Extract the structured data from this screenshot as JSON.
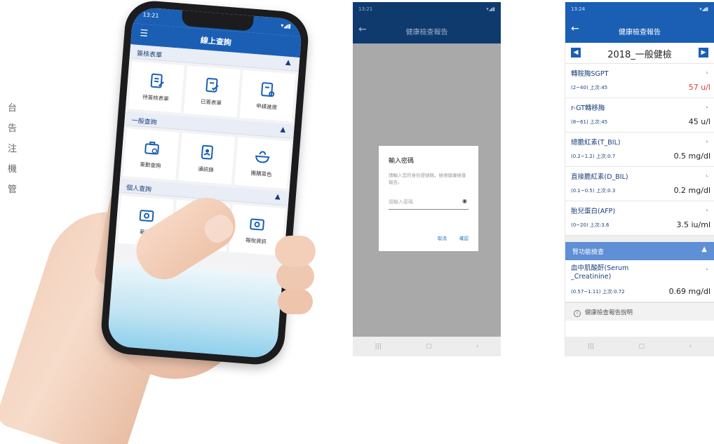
{
  "side_text": [
    "台",
    "告",
    "注",
    "機",
    "管"
  ],
  "phone1": {
    "status_time": "13:21",
    "title": "線上查詢",
    "sections": [
      {
        "name": "簽核表單",
        "tiles": [
          "待簽核表單",
          "已簽表單",
          "申請進度"
        ]
      },
      {
        "name": "一般查詢",
        "tiles": [
          "差勤查詢",
          "通訊錄",
          "團膳菜色"
        ]
      },
      {
        "name": "個人查詢",
        "tiles": [
          "薪資",
          "",
          "報稅資訊"
        ]
      }
    ]
  },
  "phone2": {
    "status_time": "13:21",
    "title": "健康檢查報告",
    "dialog": {
      "title": "輸入密碼",
      "desc": "請輸入您的身份證號碼，檢視健康檢查報告。",
      "placeholder": "請輸入密碼",
      "cancel": "取消",
      "confirm": "確認"
    }
  },
  "phone3": {
    "status_time": "13:24",
    "title": "健康檢查報告",
    "year_title": "2018_一般健檢",
    "items": [
      {
        "name": "轉胺脢SGPT",
        "range": "(2~40) 上次:45",
        "value": "57 u/l",
        "high": true
      },
      {
        "name": "r-GT轉移脢",
        "range": "(8~61) 上次:45",
        "value": "45 u/l",
        "high": false
      },
      {
        "name": "總膽紅素(T_BIL)",
        "range": "(0.2~1.2) 上次:0.7",
        "value": "0.5 mg/dl",
        "high": false
      },
      {
        "name": "直接膽紅素(D_BIL)",
        "range": "(0.1~0.5) 上次:0.3",
        "value": "0.2 mg/dl",
        "high": false
      },
      {
        "name": "胎兒蛋白(AFP)",
        "range": "(0~20) 上次:3.6",
        "value": "3.5 iu/ml",
        "high": false
      }
    ],
    "section_title": "腎功能檢查",
    "kidney_item": {
      "name": "血中肌酸酐(Serum _Creatinine)",
      "range": "(0.57~1.11) 上次:0.72",
      "value": "0.69 mg/dl"
    },
    "explain": "健康檢查報告說明"
  },
  "colors": {
    "brand_blue": "#1a5fb4",
    "alert_red": "#e53935"
  }
}
